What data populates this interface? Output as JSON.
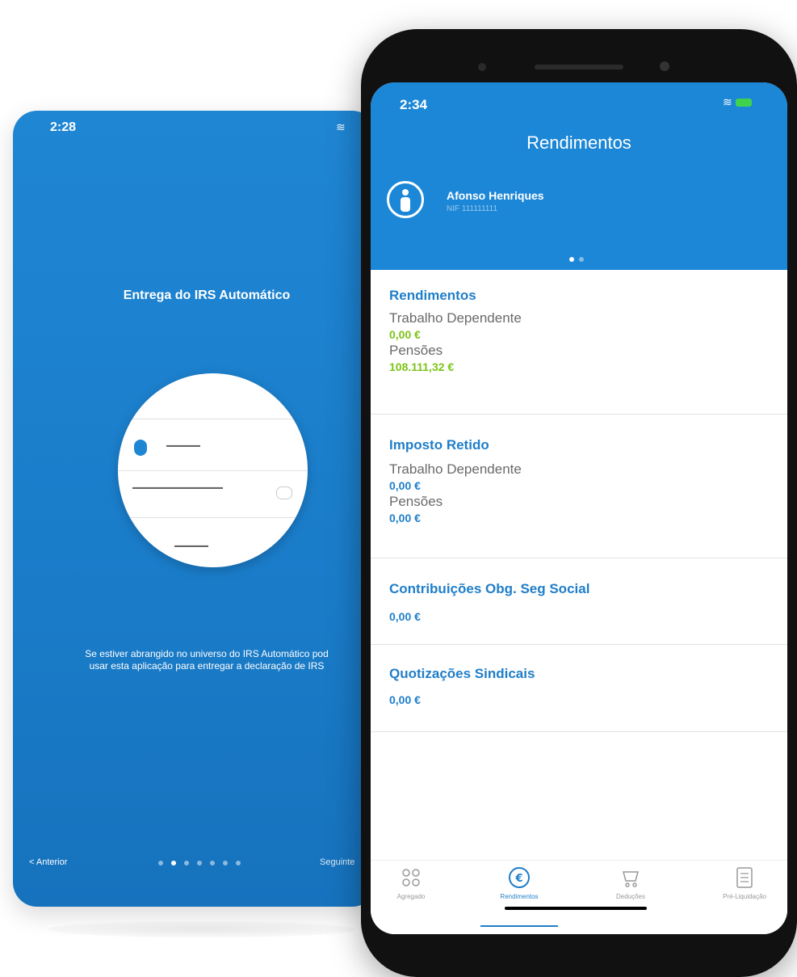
{
  "back_screen": {
    "time": "2:28",
    "title": "Entrega do IRS Automático",
    "description_line1": "Se estiver abrangido no universo do IRS Automático pod",
    "description_line2": "usar esta aplicação para entregar a declaração de IRS",
    "prev_label": "< Anterior",
    "next_label": "Seguinte",
    "dots_total": 7,
    "dots_active_index": 1
  },
  "front_screen": {
    "time": "2:34",
    "title": "Rendimentos",
    "user": {
      "name": "Afonso Henriques",
      "nif": "NIF 111111111"
    },
    "page_dots_total": 2,
    "page_dots_active_index": 0,
    "sections": {
      "rendimentos": {
        "title": "Rendimentos",
        "items": [
          {
            "label": "Trabalho Dependente",
            "value": "0,00 €"
          },
          {
            "label": "Pensões",
            "value": "108.111,32 €"
          }
        ]
      },
      "imposto_retido": {
        "title": "Imposto Retido",
        "items": [
          {
            "label": "Trabalho Dependente",
            "value": "0,00 €"
          },
          {
            "label": "Pensões",
            "value": "0,00 €"
          }
        ]
      },
      "contribuicoes": {
        "title": "Contribuições Obg. Seg Social",
        "value": "0,00 €"
      },
      "quotizacoes": {
        "title": "Quotizações Sindicais",
        "value": "0,00 €"
      }
    },
    "tabs": [
      {
        "label": "Agregado",
        "icon": "people-icon"
      },
      {
        "label": "Rendimentos",
        "icon": "euro-icon"
      },
      {
        "label": "Deduções",
        "icon": "cart-icon"
      },
      {
        "label": "Pré-Liquidação",
        "icon": "document-icon"
      }
    ]
  },
  "colors": {
    "brand_blue": "#1c87d6",
    "value_green": "#7cc417",
    "value_blue": "#1f7ec9"
  }
}
